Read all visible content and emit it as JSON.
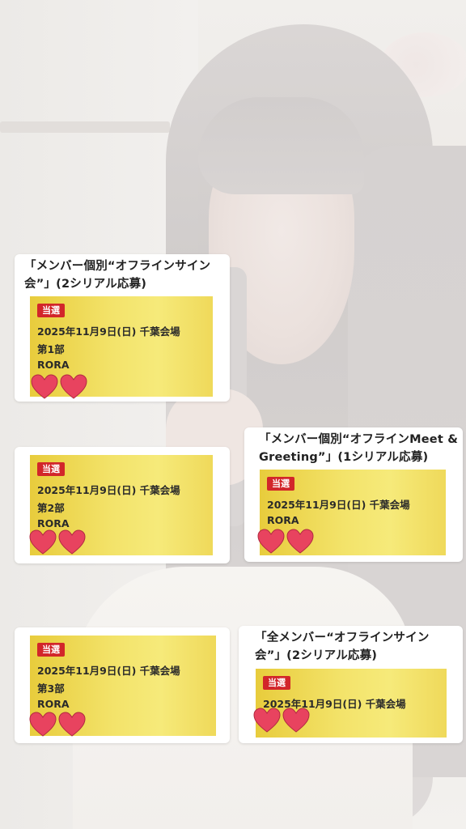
{
  "cards": [
    {
      "title_line1": "「メンバー個別“オフラインサイン",
      "title_line2": "会”」(2シリアル応募)",
      "badge": "当選",
      "date": "2025年11月9日(日) 千葉会場",
      "session": "第1部",
      "member": "RORA"
    },
    {
      "badge": "当選",
      "date": "2025年11月9日(日) 千葉会場",
      "session": "第2部",
      "member": "RORA"
    },
    {
      "title_line1": "「メンバー個別“オフラインMeet &",
      "title_line2": "Greeting”」(1シリアル応募)",
      "badge": "当選",
      "date": "2025年11月9日(日) 千葉会場",
      "member": "RORA"
    },
    {
      "badge": "当選",
      "date": "2025年11月9日(日) 千葉会場",
      "session": "第3部",
      "member": "RORA"
    },
    {
      "title_line1": "「全メンバー“オフラインサイン",
      "title_line2": "会”」(2シリアル応募)",
      "badge": "当選",
      "date": "2025年11月9日(日) 千葉会場"
    }
  ],
  "colors": {
    "badge": "#d2262a",
    "highlight": "#f3e36a",
    "heart": "#e8435f"
  },
  "sticker_icon": "heart-sticker-icon"
}
